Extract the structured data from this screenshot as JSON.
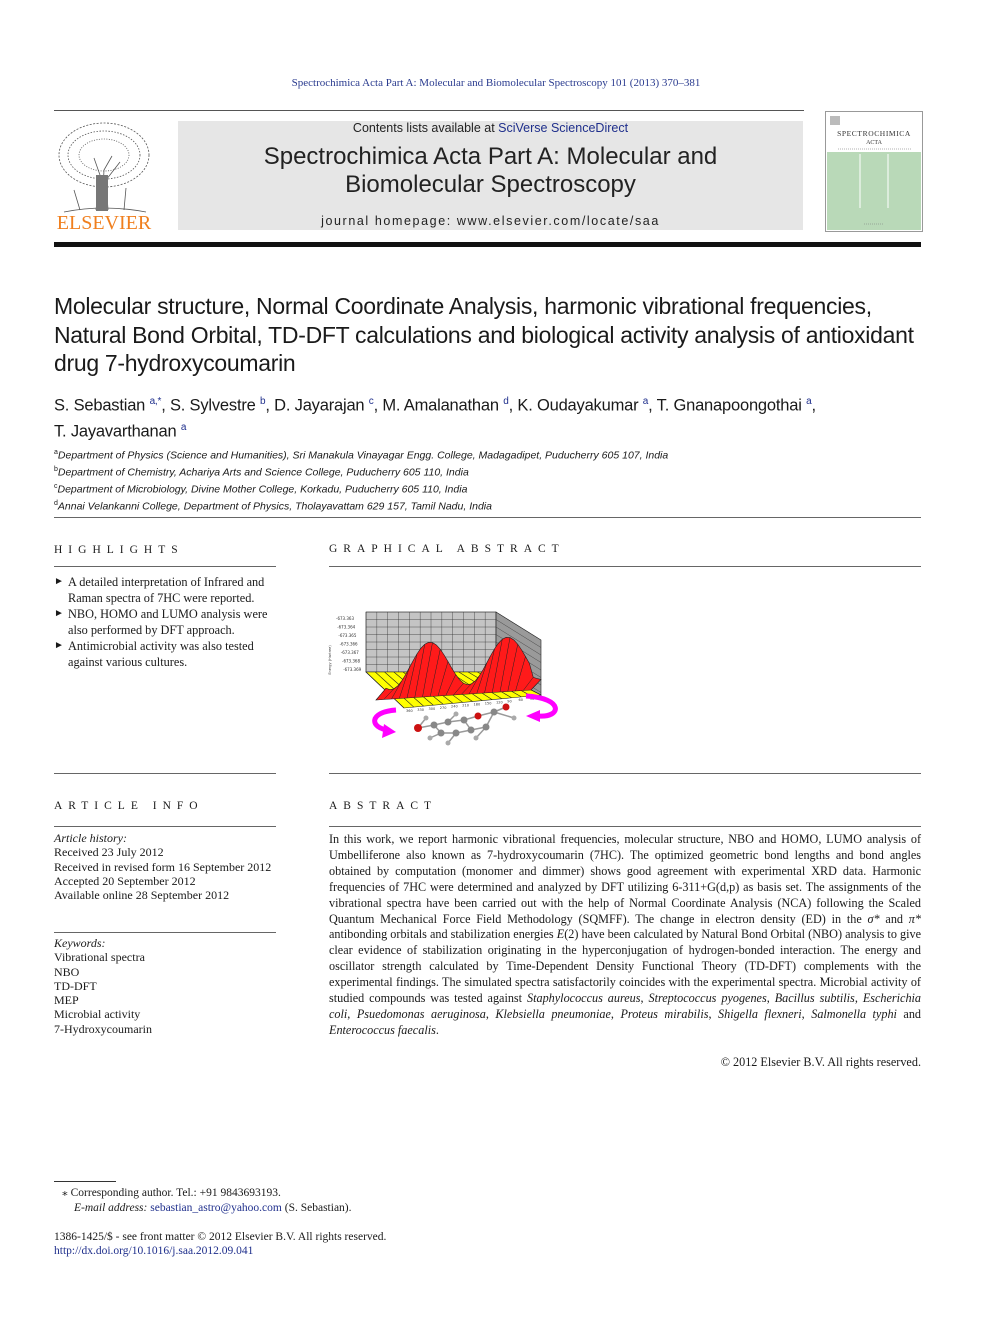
{
  "running_head": "Spectrochimica Acta Part A: Molecular and Biomolecular Spectroscopy 101 (2013) 370–381",
  "masthead": {
    "contents_prefix": "Contents lists available at ",
    "contents_link": "SciVerse ScienceDirect",
    "journal_title_line1": "Spectrochimica Acta Part A: Molecular and",
    "journal_title_line2": "Biomolecular Spectroscopy",
    "homepage_label": "journal homepage: ",
    "homepage_url": "www.elsevier.com/locate/saa",
    "publisher_logo_text": "ELSEVIER",
    "cover_title_line1": "SPECTROCHIMICA",
    "cover_title_line2": "ACTA",
    "colors": {
      "elsevier_orange": "#f07f1e",
      "cover_green": "#b9d9b8",
      "masthead_gray": "#e6e6e6",
      "link_blue": "#1f2f8c"
    }
  },
  "article": {
    "title": "Molecular structure, Normal Coordinate Analysis, harmonic vibrational frequencies, Natural Bond Orbital, TD-DFT calculations and biological activity analysis of antioxidant drug 7-hydroxycoumarin",
    "authors": [
      {
        "name": "S. Sebastian",
        "aff": "a,*",
        "sep": ", "
      },
      {
        "name": "S. Sylvestre",
        "aff": "b",
        "sep": ", "
      },
      {
        "name": "D. Jayarajan",
        "aff": "c",
        "sep": ", "
      },
      {
        "name": "M. Amalanathan",
        "aff": "d",
        "sep": ", "
      },
      {
        "name": "K. Oudayakumar",
        "aff": "a",
        "sep": ", "
      },
      {
        "name": "T. Gnanapoongothai",
        "aff": "a",
        "sep": ", "
      },
      {
        "name": "T. Jayavarthanan",
        "aff": "a",
        "sep": ""
      }
    ],
    "affiliations": [
      {
        "mark": "a",
        "text": "Department of Physics (Science and Humanities), Sri Manakula Vinayagar Engg. College, Madagadipet, Puducherry 605 107, India"
      },
      {
        "mark": "b",
        "text": "Department of Chemistry, Achariya Arts and Science College, Puducherry 605 110, India"
      },
      {
        "mark": "c",
        "text": "Department of Microbiology, Divine Mother College, Korkadu, Puducherry 605 110, India"
      },
      {
        "mark": "d",
        "text": "Annai Velankanni College, Department of Physics, Tholayavattam 629 157, Tamil Nadu, India"
      }
    ]
  },
  "highlights": {
    "heading": "HIGHLIGHTS",
    "bullet_icon": "►",
    "items": [
      "A detailed interpretation of Infrared and Raman spectra of 7HC were reported.",
      "NBO, HOMO and LUMO analysis were also performed by DFT approach.",
      "Antimicrobial activity was also tested against various cultures."
    ]
  },
  "graphical_abstract": {
    "heading": "GRAPHICAL ABSTRACT",
    "y_axis_label": "Energy (Hartree)",
    "y_tick_labels": [
      "-673.363",
      "-673.364",
      "-673.365",
      "-673.366",
      "-673.367",
      "-673.368",
      "-673.369"
    ],
    "x_tick_labels": [
      "360",
      "330",
      "300",
      "270",
      "240",
      "210",
      "180",
      "150",
      "120",
      "90",
      "60",
      "30",
      "0"
    ],
    "colors": {
      "surface": "#ff1a1a",
      "floor": "#ffff00",
      "walls": "#b0b0b0",
      "arrows": "#ff00ff",
      "oxygen": "#dd1111",
      "carbon": "#888888"
    }
  },
  "article_info": {
    "heading": "ARTICLE INFO",
    "history_label": "Article history:",
    "history": [
      "Received 23 July 2012",
      "Received in revised form 16 September 2012",
      "Accepted 20 September 2012",
      "Available online 28 September 2012"
    ],
    "keywords_label": "Keywords:",
    "keywords": [
      "Vibrational spectra",
      "NBO",
      "TD-DFT",
      "MEP",
      "Microbial activity",
      "7-Hydroxycoumarin"
    ]
  },
  "abstract": {
    "heading": "ABSTRACT",
    "p1": "In this work, we report harmonic vibrational frequencies, molecular structure, NBO and HOMO, LUMO analysis of Umbelliferone also known as 7-hydroxycoumarin (7HC). The optimized geometric bond lengths and bond angles obtained by computation (monomer and dimmer) shows good agreement with experimental XRD data. Harmonic frequencies of 7HC were determined and analyzed by DFT utilizing 6-311+G(d,p) as basis set. The assignments of the vibrational spectra have been carried out with the help of Normal Coordinate Analysis (NCA) following the Scaled Quantum Mechanical Force Field Methodology (SQMFF). The change in electron density (ED) in the ",
    "sigma": "σ*",
    "and1": " and ",
    "pi": "π*",
    "p2": " antibonding orbitals and stabilization energies ",
    "e2": "E",
    "p3": "(2) have been calculated by Natural Bond Orbital (NBO) analysis to give clear evidence of stabilization originating in the hyperconjugation of hydrogen-bonded interaction. The energy and oscillator strength calculated by Time-Dependent Density Functional Theory (TD-DFT) complements with the experimental findings. The simulated spectra satisfactorily coincides with the experimental spectra. Microbial activity of studied compounds was tested against ",
    "organisms": [
      {
        "name": "Staphylococcus aureus",
        "sep": ", "
      },
      {
        "name": "Streptococcus pyogenes",
        "sep": ", "
      },
      {
        "name": "Bacillus subtilis",
        "sep": ", "
      },
      {
        "name": "Escherichia coli",
        "sep": ", "
      },
      {
        "name": "Psuedomonas aeruginosa",
        "sep": ", "
      },
      {
        "name": "Klebsiella pneumoniae",
        "sep": ", "
      },
      {
        "name": "Proteus mirabilis",
        "sep": ", "
      },
      {
        "name": "Shigella flexneri",
        "sep": ", "
      },
      {
        "name": "Salmonella typhi",
        "sep": " and "
      },
      {
        "name": "Enterococcus faecalis",
        "sep": "."
      }
    ],
    "copyright": "© 2012 Elsevier B.V. All rights reserved."
  },
  "footer": {
    "corresponding_mark": "⁎",
    "corresponding": " Corresponding author. Tel.: +91 9843693193.",
    "email_label": "E-mail address: ",
    "email": "sebastian_astro@yahoo.com",
    "email_suffix": " (S. Sebastian).",
    "issn_line": "1386-1425/$ - see front matter © 2012 Elsevier B.V. All rights reserved.",
    "doi": "http://dx.doi.org/10.1016/j.saa.2012.09.041"
  }
}
